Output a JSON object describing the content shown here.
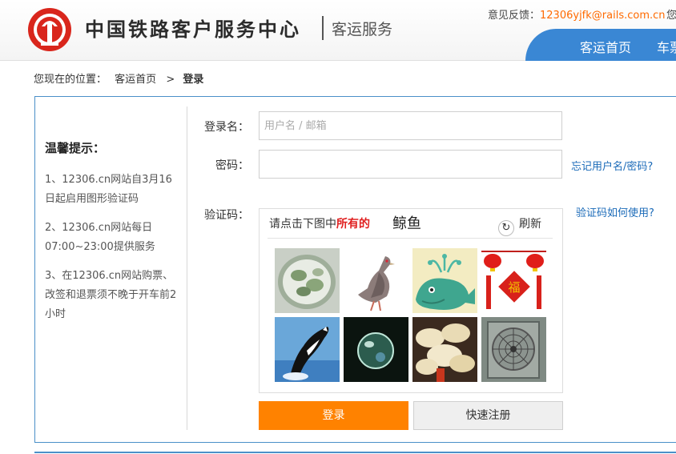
{
  "header": {
    "brand_name": "中国铁路客户服务中心",
    "brand_sub": "客运服务",
    "feedback_label": "意见反馈：",
    "feedback_email": "12306yjfk@rails.com.cn",
    "feedback_more": "您",
    "nav": [
      "客运首页",
      "车票"
    ]
  },
  "breadcrumb": {
    "prefix": "您现在的位置：",
    "home": "客运首页",
    "sep": ">",
    "current": "登录"
  },
  "tips": {
    "title": "温馨提示：",
    "items": [
      "1、12306.cn网站自3月16日起启用图形验证码",
      "2、12306.cn网站每日07:00~23:00提供服务",
      "3、在12306.cn网站购票、改签和退票须不晚于开车前2小时"
    ]
  },
  "form": {
    "username_label": "登录名：",
    "username_placeholder": "用户名 / 邮箱",
    "username_value": "",
    "password_label": "密码：",
    "password_value": "",
    "forgot_link": "忘记用户名/密码?",
    "captcha_label": "验证码：",
    "captcha_help": "验证码如何使用?"
  },
  "captcha": {
    "prompt_prefix": "请点击下图中",
    "prompt_highlight": "所有的",
    "target": "鲸鱼",
    "refresh_icon": "refresh-icon",
    "refresh_label": "刷新"
  },
  "buttons": {
    "login": "登录",
    "register": "快速注册"
  },
  "colors": {
    "nav_bg": "#3a87d4",
    "login_btn": "#ff8200",
    "link": "#1a6ab8",
    "highlight": "#e02020",
    "email": "#ff6a00"
  }
}
